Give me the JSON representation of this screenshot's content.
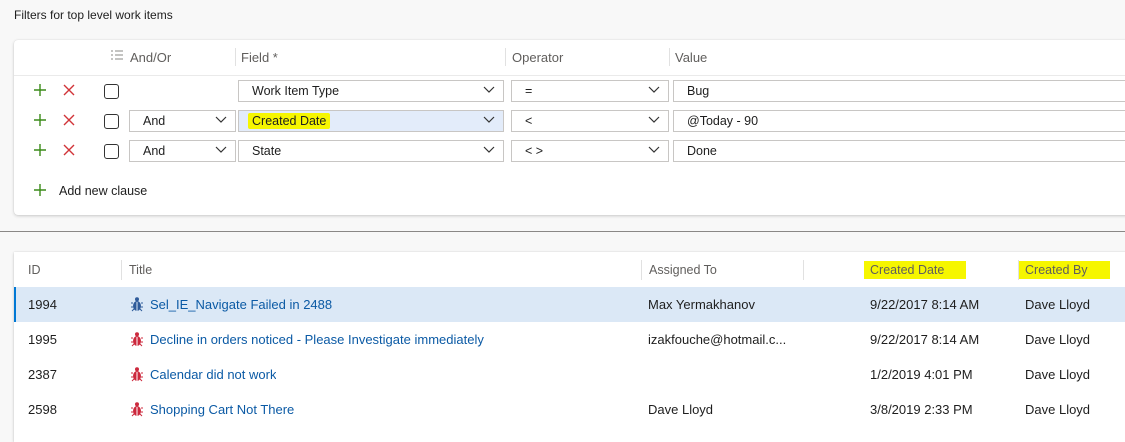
{
  "section_title": "Filters for top level work items",
  "filter": {
    "headers": {
      "and_or": "And/Or",
      "field": "Field *",
      "operator": "Operator",
      "value": "Value"
    },
    "clauses": [
      {
        "and_or": "",
        "field": "Work Item Type",
        "operator": "=",
        "value": "Bug",
        "highlighted": false
      },
      {
        "and_or": "And",
        "field": "Created Date",
        "operator": "<",
        "value": "@Today - 90",
        "highlighted": true
      },
      {
        "and_or": "And",
        "field": "State",
        "operator": "< >",
        "value": "Done",
        "highlighted": false
      }
    ],
    "add_clause_label": "Add new clause"
  },
  "results": {
    "headers": {
      "id": "ID",
      "title": "Title",
      "assigned_to": "Assigned To",
      "created_date": "Created Date",
      "created_by": "Created By"
    },
    "rows": [
      {
        "id": "1994",
        "title": "Sel_IE_Navigate Failed in 2488",
        "assigned_to": "Max Yermakhanov",
        "created_date": "9/22/2017 8:14 AM",
        "created_by": "Dave Lloyd",
        "icon": "bug-icon-blue",
        "selected": true
      },
      {
        "id": "1995",
        "title": "Decline in orders noticed - Please Investigate immediately",
        "assigned_to": "izakfouche@hotmail.c...",
        "created_date": "9/22/2017 8:14 AM",
        "created_by": "Dave Lloyd",
        "icon": "bug-icon-red"
      },
      {
        "id": "2387",
        "title": "Calendar did not work",
        "assigned_to": "",
        "created_date": "1/2/2019 4:01 PM",
        "created_by": "Dave Lloyd",
        "icon": "bug-icon-red"
      },
      {
        "id": "2598",
        "title": "Shopping Cart Not There",
        "assigned_to": "Dave Lloyd",
        "created_date": "3/8/2019 2:33 PM",
        "created_by": "Dave Lloyd",
        "icon": "bug-icon-red"
      }
    ]
  },
  "colors": {
    "accent": "#0078d4",
    "link": "#0b5aa5",
    "highlight": "#f6f600",
    "selected_row": "#dbe8f6",
    "add": "#3a8a18",
    "delete": "#d13438",
    "bug_red": "#cc293d"
  }
}
